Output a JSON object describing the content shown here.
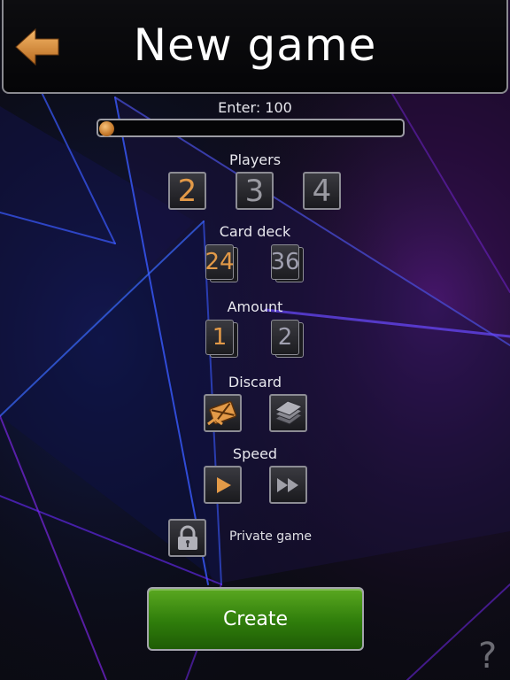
{
  "header": {
    "title": "New game"
  },
  "enter": {
    "label": "Enter: 100",
    "slider_fraction": 0.0
  },
  "players": {
    "label": "Players",
    "options": [
      "2",
      "3",
      "4"
    ],
    "selected": "2"
  },
  "card_deck": {
    "label": "Card deck",
    "options": [
      "24",
      "36"
    ],
    "selected": "24"
  },
  "amount": {
    "label": "Amount",
    "options": [
      "1",
      "2"
    ],
    "selected": "1"
  },
  "discard": {
    "label": "Discard",
    "icons": [
      "discard-cards-icon",
      "card-stack-icon"
    ]
  },
  "speed": {
    "label": "Speed",
    "icons": [
      "play-icon",
      "fast-forward-icon"
    ]
  },
  "private_game": {
    "label": "Private game",
    "icon": "lock-icon"
  },
  "create": {
    "label": "Create"
  },
  "help": {
    "label": "?"
  },
  "colors": {
    "accent": "#e39a48",
    "button_green": "#3f8f12",
    "background": "#0b0b12",
    "purple_glow": "#5a1a8a"
  }
}
